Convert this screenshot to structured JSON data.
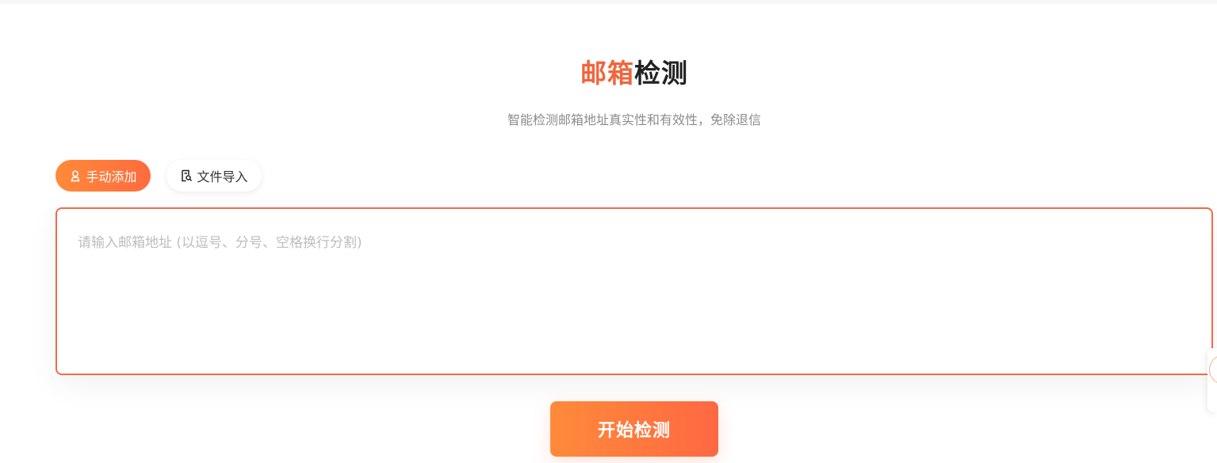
{
  "header": {
    "title_accent": "邮箱",
    "title_rest": "检测",
    "subtitle": "智能检测邮箱地址真实性和有效性，免除退信"
  },
  "tabs": [
    {
      "label": "手动添加",
      "icon": "user-icon",
      "active": true
    },
    {
      "label": "文件导入",
      "icon": "file-search-icon",
      "active": false
    }
  ],
  "input": {
    "value": "",
    "placeholder": "请输入邮箱地址 (以逗号、分号、空格换行分割)"
  },
  "actions": {
    "start_label": "开始检测"
  },
  "colors": {
    "accent": "#f2643c",
    "gradient_start": "#ff8a3a",
    "gradient_end": "#ff6842",
    "border": "#f26a4b",
    "title_dark": "#222222",
    "subtitle": "#8c8c8c"
  }
}
